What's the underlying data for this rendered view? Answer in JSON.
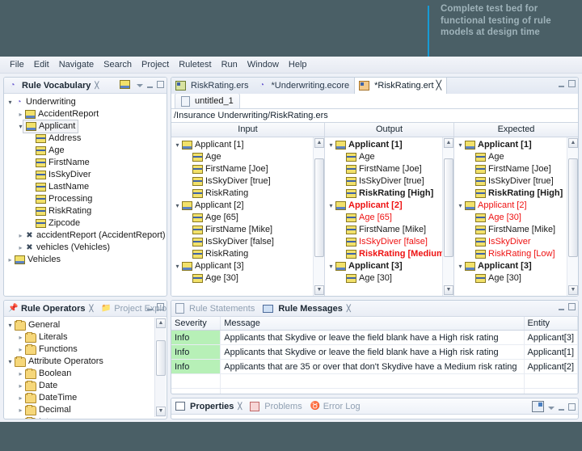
{
  "callout": {
    "text": "Complete test bed for functional testing of rule models at design time",
    "accent_color": "#169bd5"
  },
  "background_color": "#4a5f66",
  "menubar": {
    "items": [
      "File",
      "Edit",
      "Navigate",
      "Search",
      "Project",
      "Ruletest",
      "Run",
      "Window",
      "Help"
    ]
  },
  "vocabulary_view": {
    "tab_label": "Rule Vocabulary",
    "tree": [
      {
        "label": "Underwriting",
        "icon": "vocabulary-icon",
        "indent": 0,
        "arrow": "open"
      },
      {
        "label": "AccidentReport",
        "icon": "package-icon",
        "indent": 1,
        "arrow": "closed"
      },
      {
        "label": "Applicant",
        "icon": "package-icon",
        "indent": 1,
        "arrow": "open",
        "selected": true
      },
      {
        "label": "Address",
        "icon": "attribute-icon",
        "indent": 2,
        "arrow": "none"
      },
      {
        "label": "Age",
        "icon": "attribute-icon",
        "indent": 2,
        "arrow": "none"
      },
      {
        "label": "FirstName",
        "icon": "attribute-icon",
        "indent": 2,
        "arrow": "none"
      },
      {
        "label": "IsSkyDiver",
        "icon": "attribute-icon",
        "indent": 2,
        "arrow": "none"
      },
      {
        "label": "LastName",
        "icon": "attribute-icon",
        "indent": 2,
        "arrow": "none"
      },
      {
        "label": "Processing",
        "icon": "attribute-icon",
        "indent": 2,
        "arrow": "none"
      },
      {
        "label": "RiskRating",
        "icon": "attribute-icon",
        "indent": 2,
        "arrow": "none"
      },
      {
        "label": "Zipcode",
        "icon": "attribute-icon",
        "indent": 2,
        "arrow": "none"
      },
      {
        "label": "accidentReport (AccidentReport)",
        "icon": "reference-icon",
        "indent": 1,
        "arrow": "closed"
      },
      {
        "label": "vehicles (Vehicles)",
        "icon": "reference-icon",
        "indent": 1,
        "arrow": "closed"
      },
      {
        "label": "Vehicles",
        "icon": "package-icon",
        "indent": 0,
        "arrow": "closed"
      }
    ]
  },
  "operators_view": {
    "tabs": [
      {
        "label": "Rule Operators",
        "active": true,
        "icon": "pin-icon"
      },
      {
        "label": "Project Explorer",
        "active": false,
        "icon": "explorer-icon"
      }
    ],
    "tree": [
      {
        "label": "General",
        "icon": "folder-icon",
        "indent": 0,
        "arrow": "open"
      },
      {
        "label": "Literals",
        "icon": "folder-icon",
        "indent": 1,
        "arrow": "closed"
      },
      {
        "label": "Functions",
        "icon": "folder-icon",
        "indent": 1,
        "arrow": "closed"
      },
      {
        "label": "Attribute Operators",
        "icon": "folder-icon",
        "indent": 0,
        "arrow": "open"
      },
      {
        "label": "Boolean",
        "icon": "folder-icon",
        "indent": 1,
        "arrow": "closed"
      },
      {
        "label": "Date",
        "icon": "folder-icon",
        "indent": 1,
        "arrow": "closed"
      },
      {
        "label": "DateTime",
        "icon": "folder-icon",
        "indent": 1,
        "arrow": "closed"
      },
      {
        "label": "Decimal",
        "icon": "folder-icon",
        "indent": 1,
        "arrow": "closed"
      },
      {
        "label": "Integer",
        "icon": "folder-icon",
        "indent": 1,
        "arrow": "closed"
      }
    ]
  },
  "editor": {
    "tabs": [
      {
        "label": "RiskRating.ers",
        "active": false,
        "icon": "ers-icon"
      },
      {
        "label": "*Underwriting.ecore",
        "active": false,
        "icon": "ecore-icon"
      },
      {
        "label": "*RiskRating.ert",
        "active": true,
        "icon": "ert-icon"
      }
    ],
    "subtab": {
      "label": "untitled_1",
      "icon": "file-icon"
    },
    "path": "/Insurance Underwriting/RiskRating.ers",
    "columns": [
      {
        "header": "Input"
      },
      {
        "header": "Output"
      },
      {
        "header": "Expected"
      }
    ],
    "input_tree": [
      {
        "label": "Applicant [1]",
        "icon": "package-icon",
        "indent": 0,
        "arrow": "open",
        "style": "normal"
      },
      {
        "label": "Age",
        "icon": "attribute-icon",
        "indent": 1,
        "arrow": "none",
        "style": "normal"
      },
      {
        "label": "FirstName [Joe]",
        "icon": "attribute-icon",
        "indent": 1,
        "arrow": "none",
        "style": "normal"
      },
      {
        "label": "IsSkyDiver [true]",
        "icon": "attribute-icon",
        "indent": 1,
        "arrow": "none",
        "style": "normal"
      },
      {
        "label": "RiskRating",
        "icon": "attribute-icon",
        "indent": 1,
        "arrow": "none",
        "style": "normal"
      },
      {
        "label": "Applicant [2]",
        "icon": "package-icon",
        "indent": 0,
        "arrow": "open",
        "style": "normal"
      },
      {
        "label": "Age [65]",
        "icon": "attribute-icon",
        "indent": 1,
        "arrow": "none",
        "style": "normal"
      },
      {
        "label": "FirstName [Mike]",
        "icon": "attribute-icon",
        "indent": 1,
        "arrow": "none",
        "style": "normal"
      },
      {
        "label": "IsSkyDiver [false]",
        "icon": "attribute-icon",
        "indent": 1,
        "arrow": "none",
        "style": "normal"
      },
      {
        "label": "RiskRating",
        "icon": "attribute-icon",
        "indent": 1,
        "arrow": "none",
        "style": "normal"
      },
      {
        "label": "Applicant [3]",
        "icon": "package-icon",
        "indent": 0,
        "arrow": "open",
        "style": "normal"
      },
      {
        "label": "Age [30]",
        "icon": "attribute-icon",
        "indent": 1,
        "arrow": "none",
        "style": "normal"
      }
    ],
    "output_tree": [
      {
        "label": "Applicant [1]",
        "icon": "package-icon",
        "indent": 0,
        "arrow": "open",
        "style": "bold"
      },
      {
        "label": "Age",
        "icon": "attribute-icon",
        "indent": 1,
        "arrow": "none",
        "style": "normal"
      },
      {
        "label": "FirstName [Joe]",
        "icon": "attribute-icon",
        "indent": 1,
        "arrow": "none",
        "style": "normal"
      },
      {
        "label": "IsSkyDiver [true]",
        "icon": "attribute-icon",
        "indent": 1,
        "arrow": "none",
        "style": "normal"
      },
      {
        "label": "RiskRating [High]",
        "icon": "attribute-icon",
        "indent": 1,
        "arrow": "none",
        "style": "bold"
      },
      {
        "label": "Applicant [2]",
        "icon": "package-icon",
        "indent": 0,
        "arrow": "open",
        "style": "redbold"
      },
      {
        "label": "Age [65]",
        "icon": "attribute-icon",
        "indent": 1,
        "arrow": "none",
        "style": "red"
      },
      {
        "label": "FirstName [Mike]",
        "icon": "attribute-icon",
        "indent": 1,
        "arrow": "none",
        "style": "normal"
      },
      {
        "label": "IsSkyDiver [false]",
        "icon": "attribute-icon",
        "indent": 1,
        "arrow": "none",
        "style": "red"
      },
      {
        "label": "RiskRating [Medium]",
        "icon": "attribute-icon",
        "indent": 1,
        "arrow": "none",
        "style": "redbold"
      },
      {
        "label": "Applicant [3]",
        "icon": "package-icon",
        "indent": 0,
        "arrow": "open",
        "style": "bold"
      },
      {
        "label": "Age [30]",
        "icon": "attribute-icon",
        "indent": 1,
        "arrow": "none",
        "style": "normal"
      }
    ],
    "expected_tree": [
      {
        "label": "Applicant [1]",
        "icon": "package-icon",
        "indent": 0,
        "arrow": "open",
        "style": "bold"
      },
      {
        "label": "Age",
        "icon": "attribute-icon",
        "indent": 1,
        "arrow": "none",
        "style": "normal"
      },
      {
        "label": "FirstName [Joe]",
        "icon": "attribute-icon",
        "indent": 1,
        "arrow": "none",
        "style": "normal"
      },
      {
        "label": "IsSkyDiver [true]",
        "icon": "attribute-icon",
        "indent": 1,
        "arrow": "none",
        "style": "normal"
      },
      {
        "label": "RiskRating [High]",
        "icon": "attribute-icon",
        "indent": 1,
        "arrow": "none",
        "style": "bold"
      },
      {
        "label": "Applicant [2]",
        "icon": "package-icon",
        "indent": 0,
        "arrow": "open",
        "style": "red"
      },
      {
        "label": "Age [30]",
        "icon": "attribute-icon",
        "indent": 1,
        "arrow": "none",
        "style": "red"
      },
      {
        "label": "FirstName [Mike]",
        "icon": "attribute-icon",
        "indent": 1,
        "arrow": "none",
        "style": "normal"
      },
      {
        "label": "IsSkyDiver",
        "icon": "attribute-icon",
        "indent": 1,
        "arrow": "none",
        "style": "red"
      },
      {
        "label": "RiskRating [Low]",
        "icon": "attribute-icon",
        "indent": 1,
        "arrow": "none",
        "style": "red"
      },
      {
        "label": "Applicant [3]",
        "icon": "package-icon",
        "indent": 0,
        "arrow": "open",
        "style": "bold"
      },
      {
        "label": "Age [30]",
        "icon": "attribute-icon",
        "indent": 1,
        "arrow": "none",
        "style": "normal"
      }
    ]
  },
  "messages_view": {
    "tabs": [
      {
        "label": "Rule Statements",
        "active": false,
        "icon": "statements-icon"
      },
      {
        "label": "Rule Messages",
        "active": true,
        "icon": "messages-icon"
      }
    ],
    "headers": [
      "Severity",
      "Message",
      "Entity"
    ],
    "rows": [
      {
        "severity": "Info",
        "message": "Applicants that Skydive or leave the field blank have a High risk rating",
        "entity": "Applicant[3]"
      },
      {
        "severity": "Info",
        "message": "Applicants that Skydive or leave the field blank have a High risk rating",
        "entity": "Applicant[1]"
      },
      {
        "severity": "Info",
        "message": "Applicants that are 35 or over that don't Skydive have a Medium risk rating",
        "entity": "Applicant[2]"
      }
    ],
    "severity_bg": "#b7f0b7"
  },
  "properties_view": {
    "tabs": [
      {
        "label": "Properties",
        "active": true,
        "icon": "properties-icon"
      },
      {
        "label": "Problems",
        "active": false,
        "icon": "problems-icon"
      },
      {
        "label": "Error Log",
        "active": false,
        "icon": "error-log-icon"
      }
    ]
  }
}
